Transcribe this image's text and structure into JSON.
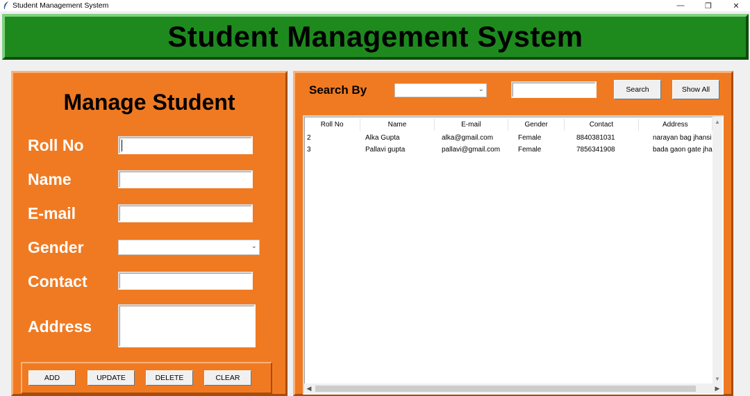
{
  "window": {
    "title": "Student Management System",
    "controls": {
      "minimize": "—",
      "restore": "❐",
      "close": "✕"
    }
  },
  "banner": {
    "title": "Student Management System"
  },
  "manage": {
    "heading": "Manage Student",
    "labels": {
      "roll_no": "Roll No",
      "name": "Name",
      "email": "E-mail",
      "gender": "Gender",
      "contact": "Contact",
      "address": "Address"
    },
    "values": {
      "roll_no": "",
      "name": "",
      "email": "",
      "gender": "",
      "contact": "",
      "address": ""
    },
    "buttons": {
      "add": "ADD",
      "update": "UPDATE",
      "delete": "DELETE",
      "clear": "CLEAR"
    }
  },
  "search": {
    "label": "Search By",
    "by_value": "",
    "text_value": "",
    "search_button": "Search",
    "show_all_button": "Show All"
  },
  "table": {
    "columns": [
      "Roll No",
      "Name",
      "E-mail",
      "Gender",
      "Contact",
      "Address"
    ],
    "rows": [
      [
        "2",
        "Alka Gupta",
        "alka@gmail.com",
        "Female",
        "8840381031",
        "narayan bag jhansi"
      ],
      [
        "3",
        "Pallavi gupta",
        "pallavi@gmail.com",
        "Female",
        "7856341908",
        "bada gaon gate jha"
      ]
    ]
  },
  "colors": {
    "banner_green": "#1e8a1e",
    "panel_orange": "#f07a22"
  },
  "icons": {
    "app": "feather-icon",
    "dropdown": "chevron-down-icon",
    "scroll_up": "arrow-up-icon",
    "scroll_down": "arrow-down-icon",
    "scroll_left": "arrow-left-icon",
    "scroll_right": "arrow-right-icon"
  }
}
